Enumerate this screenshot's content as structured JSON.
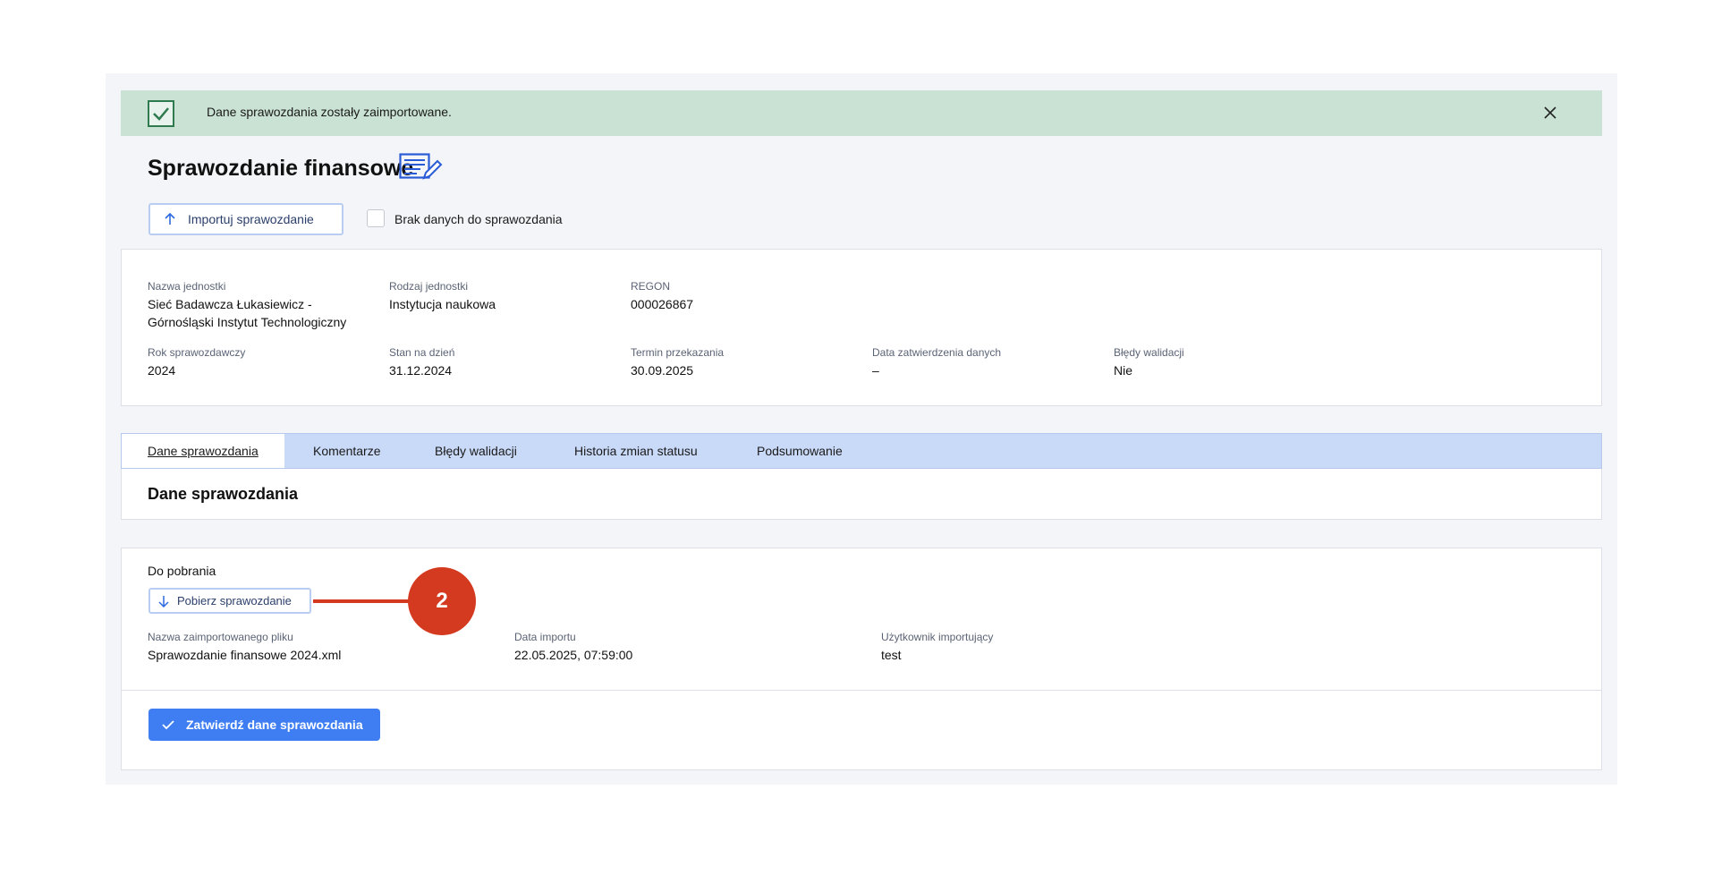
{
  "banner": {
    "message": "Dane sprawozdania zostały zaimportowane.",
    "icon": "check-square-icon",
    "close_icon": "close-icon"
  },
  "header": {
    "title": "Sprawozdanie finansowe",
    "title_icon": "document-edit-icon"
  },
  "actions": {
    "import_label": "Importuj sprawozdanie",
    "no_data_label": "Brak danych do sprawozdania"
  },
  "info": {
    "unit_name": {
      "label": "Nazwa jednostki",
      "value_line1": "Sieć Badawcza Łukasiewicz -",
      "value_line2": "Górnośląski Instytut Technologiczny"
    },
    "unit_type": {
      "label": "Rodzaj jednostki",
      "value": "Instytucja naukowa"
    },
    "regon": {
      "label": "REGON",
      "value": "000026867"
    },
    "year": {
      "label": "Rok sprawozdawczy",
      "value": "2024"
    },
    "as_of": {
      "label": "Stan na dzień",
      "value": "31.12.2024"
    },
    "deadline": {
      "label": "Termin przekazania",
      "value": "30.09.2025"
    },
    "approval_date": {
      "label": "Data zatwierdzenia danych",
      "value": "–"
    },
    "validation_errors": {
      "label": "Błędy walidacji",
      "value": "Nie"
    }
  },
  "tabs": [
    "Dane sprawozdania",
    "Komentarze",
    "Błędy walidacji",
    "Historia zmian statusu",
    "Podsumowanie"
  ],
  "section": {
    "title": "Dane sprawozdania"
  },
  "download": {
    "title": "Do pobrania",
    "button_label": "Pobierz sprawozdanie",
    "file_name": {
      "label": "Nazwa zaimportowanego pliku",
      "value": "Sprawozdanie finansowe 2024.xml"
    },
    "import_date": {
      "label": "Data importu",
      "value": "22.05.2025, 07:59:00"
    },
    "user": {
      "label": "Użytkownik importujący",
      "value": "test"
    }
  },
  "confirm": {
    "label": "Zatwierdź dane sprawozdania"
  },
  "annotation": {
    "number": "2",
    "color": "#d33a20"
  },
  "colors": {
    "accent": "#3f7ef2",
    "success_bg": "#c9e2d3",
    "tabs_bg": "#c9d9f8"
  }
}
